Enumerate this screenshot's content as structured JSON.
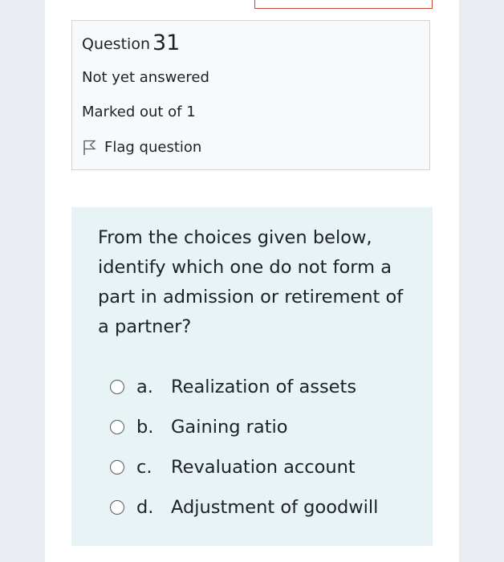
{
  "question_info": {
    "label": "Question",
    "number": "31",
    "state": "Not yet answered",
    "grade": "Marked out of 1",
    "flag_label": "Flag question"
  },
  "question": {
    "text": "From the choices given below, identify which one do not form a part in admission or retirement of a partner?",
    "answers": [
      {
        "letter": "a.",
        "text": "Realization of assets"
      },
      {
        "letter": "b.",
        "text": "Gaining ratio"
      },
      {
        "letter": "c.",
        "text": "Revaluation account"
      },
      {
        "letter": "d.",
        "text": "Adjustment of goodwill"
      }
    ]
  },
  "colors": {
    "page_background": "#e9edf1",
    "info_background": "#f8f9fa",
    "formulation_background": "#e7f3f5",
    "text": "#1d2125",
    "previous_box_border": "#c0493a"
  }
}
